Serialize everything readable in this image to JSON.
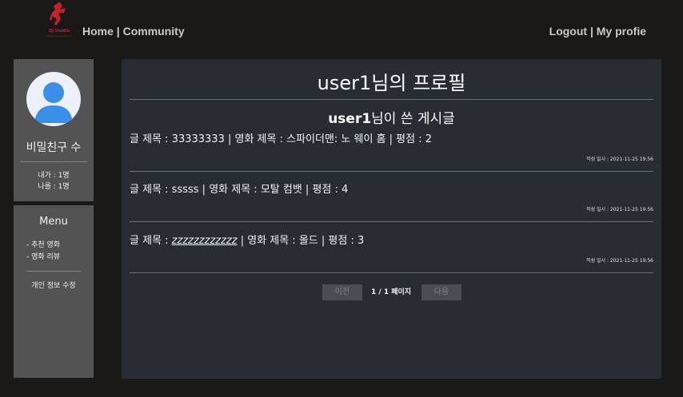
{
  "header": {
    "logo_text": "DJ Studio",
    "logo_sub": "Movie Review Board",
    "nav_home": "Home",
    "nav_separator": " | ",
    "nav_community": "Community",
    "nav_logout": "Logout",
    "nav_my_profile": "My profie"
  },
  "sidebar": {
    "friends_title": "비밀친구 수",
    "mine_count": "내가 : 1명",
    "others_count": "나를 : 1명",
    "menu_title": "Menu",
    "menu_items": [
      "- 추천 영화",
      "- 영화 리뷰"
    ],
    "edit_profile": "개인 정보 수정"
  },
  "main": {
    "page_title": "user1님의 프로필",
    "posts_user": "user1",
    "posts_suffix": "님이 쓴 게시글",
    "posts": [
      {
        "title_label": "글 제목 : ",
        "title": "33333333",
        "movie_label": " | 영화 제목 : ",
        "movie": "스파이더맨: 노 웨이 홈",
        "score_label": " | 평점 : ",
        "score": "2",
        "date": "작성 일시 : 2021-11-25 19:56"
      },
      {
        "title_label": "글 제목 : ",
        "title": "sssss",
        "movie_label": " | 영화 제목 : ",
        "movie": "모탈 컴뱃",
        "score_label": " | 평점 : ",
        "score": "4",
        "date": "작성 일시 : 2021-11-25 19:56"
      },
      {
        "title_label": "글 제목 : ",
        "title": "zzzzzzzzzzzz",
        "movie_label": " | 영화 제목 : ",
        "movie": "올드",
        "score_label": " | 평점 : ",
        "score": "3",
        "date": "작성 일시 : 2021-11-25 19:56"
      }
    ]
  },
  "pagination": {
    "prev": "이전",
    "info": "1 / 1 페이지",
    "next": "다음"
  },
  "colors": {
    "background": "#1b1918",
    "panel": "#535353",
    "main_panel": "#272d33",
    "logo_red": "#c8202a"
  },
  "icons": {
    "logo": "dancer-logo-icon",
    "avatar": "user-avatar-icon"
  }
}
